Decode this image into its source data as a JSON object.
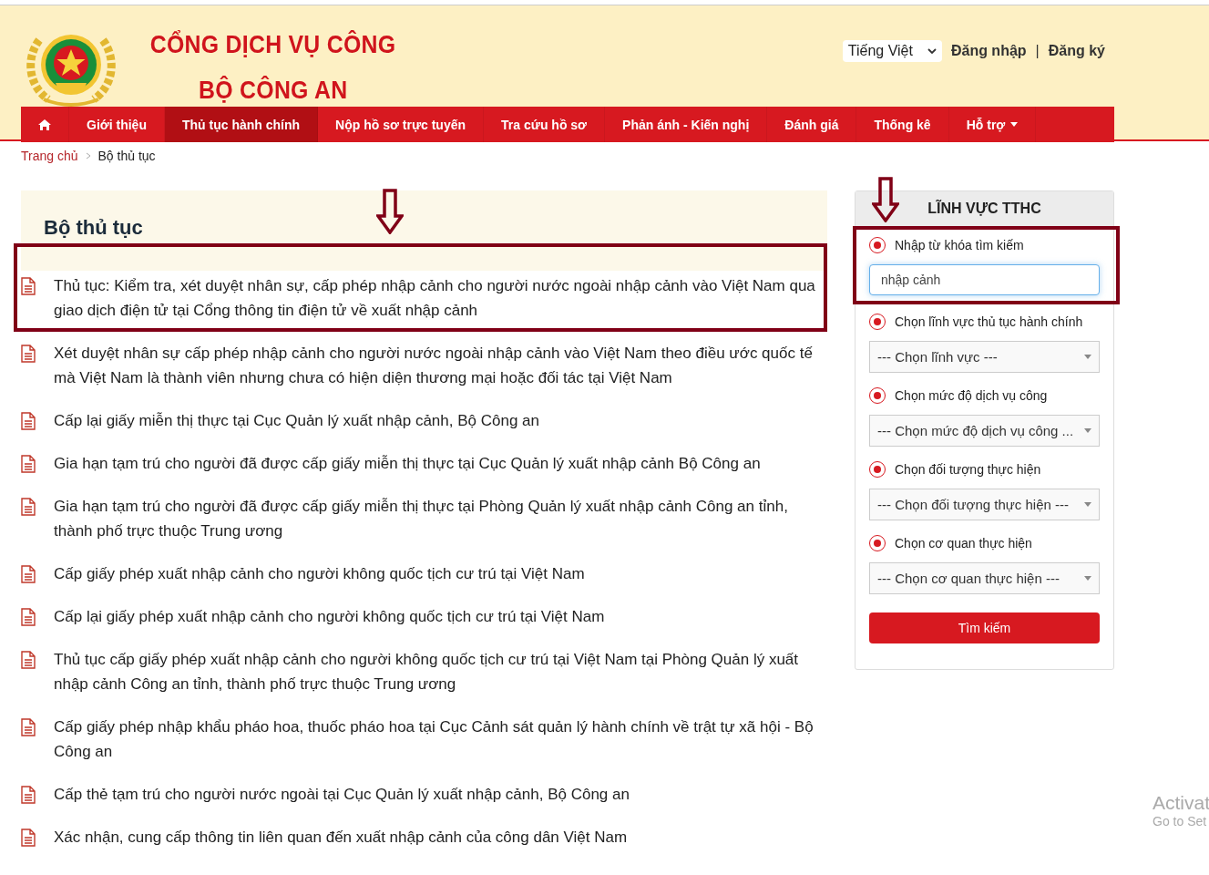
{
  "header": {
    "title_line1": "CỔNG DỊCH VỤ CÔNG",
    "title_line2": "BỘ CÔNG AN",
    "language": "Tiếng Việt",
    "login": "Đăng nhập",
    "separator": "|",
    "register": "Đăng ký"
  },
  "nav": [
    {
      "kind": "home",
      "selected": false
    },
    {
      "kind": "link",
      "label": "Giới thiệu",
      "selected": false
    },
    {
      "kind": "link",
      "label": "Thủ tục hành chính",
      "selected": true
    },
    {
      "kind": "link",
      "label": "Nộp hồ sơ trực tuyến",
      "selected": false
    },
    {
      "kind": "link",
      "label": "Tra cứu hồ sơ",
      "selected": false
    },
    {
      "kind": "link",
      "label": "Phản ánh - Kiến nghị",
      "selected": false
    },
    {
      "kind": "link",
      "label": "Đánh giá",
      "selected": false
    },
    {
      "kind": "link",
      "label": "Thống kê",
      "selected": false
    },
    {
      "kind": "dropdown",
      "label": "Hỗ trợ",
      "selected": false
    }
  ],
  "breadcrumb": [
    {
      "label": "Trang chủ"
    },
    {
      "label": "Bộ thủ tục"
    }
  ],
  "main": {
    "title": "Bộ thủ tục",
    "procedures": [
      {
        "text": "Thủ tục: Kiểm tra, xét duyệt nhân sự, cấp phép nhập cảnh cho người nước ngoài nhập cảnh vào Việt Nam qua giao dịch điện tử tại Cổng thông tin điện tử về xuất nhập cảnh",
        "highlighted": true
      },
      {
        "text": "Xét duyệt nhân sự cấp phép nhập cảnh cho người nước ngoài nhập cảnh vào Việt Nam theo điều ước quốc tế mà Việt Nam là thành viên nhưng chưa có hiện diện thương mại hoặc đối tác tại Việt Nam",
        "highlighted": false
      },
      {
        "text": "Cấp lại giấy miễn thị thực tại Cục Quản lý xuất nhập cảnh, Bộ Công an",
        "highlighted": false
      },
      {
        "text": "Gia hạn tạm trú cho người đã được cấp giấy miễn thị thực tại Cục Quản lý xuất nhập cảnh Bộ Công an",
        "highlighted": false
      },
      {
        "text": "Gia hạn tạm trú cho người đã được cấp giấy miễn thị thực tại Phòng Quản lý xuất nhập cảnh Công an tỉnh, thành phố trực thuộc Trung ương",
        "highlighted": false
      },
      {
        "text": "Cấp giấy phép xuất nhập cảnh cho người không quốc tịch cư trú tại Việt Nam",
        "highlighted": false
      },
      {
        "text": "Cấp lại giấy phép xuất nhập cảnh cho người không quốc tịch cư trú tại Việt Nam",
        "highlighted": false
      },
      {
        "text": "Thủ tục cấp giấy phép xuất nhập cảnh cho người không quốc tịch cư trú tại Việt Nam tại Phòng Quản lý xuất nhập cảnh Công an tỉnh, thành phố trực thuộc Trung ương",
        "highlighted": false
      },
      {
        "text": "Cấp giấy phép nhập khẩu pháo hoa, thuốc pháo hoa tại Cục Cảnh sát quản lý hành chính về trật tự xã hội - Bộ Công an",
        "highlighted": false
      },
      {
        "text": "Cấp thẻ tạm trú cho người nước ngoài tại Cục Quản lý xuất nhập cảnh, Bộ Công an",
        "highlighted": false
      },
      {
        "text": "Xác nhận, cung cấp thông tin liên quan đến xuất nhập cảnh của công dân Việt Nam",
        "highlighted": false
      }
    ]
  },
  "sidebar": {
    "title": "LĨNH VỰC TTHC",
    "filters": [
      {
        "kind": "text",
        "label": "Nhập từ khóa tìm kiếm",
        "value": "nhập cảnh",
        "selected": true,
        "highlighted": true
      },
      {
        "kind": "select",
        "label": "Chọn lĩnh vực thủ tục hành chính",
        "value": "--- Chọn lĩnh vực ---",
        "selected": true,
        "highlighted": false
      },
      {
        "kind": "select",
        "label": "Chọn mức độ dịch vụ công",
        "value": "--- Chọn mức độ dịch vụ công ...",
        "selected": true,
        "highlighted": false
      },
      {
        "kind": "select",
        "label": "Chọn đối tượng thực hiện",
        "value": "--- Chọn đối tượng thực hiện ---",
        "selected": true,
        "highlighted": false
      },
      {
        "kind": "select",
        "label": "Chọn cơ quan thực hiện",
        "value": "--- Chọn cơ quan thực hiện ---",
        "selected": true,
        "highlighted": false
      }
    ],
    "button": "Tìm kiếm"
  },
  "os_notice": {
    "line1": "Activat",
    "line2": "Go to Set"
  }
}
